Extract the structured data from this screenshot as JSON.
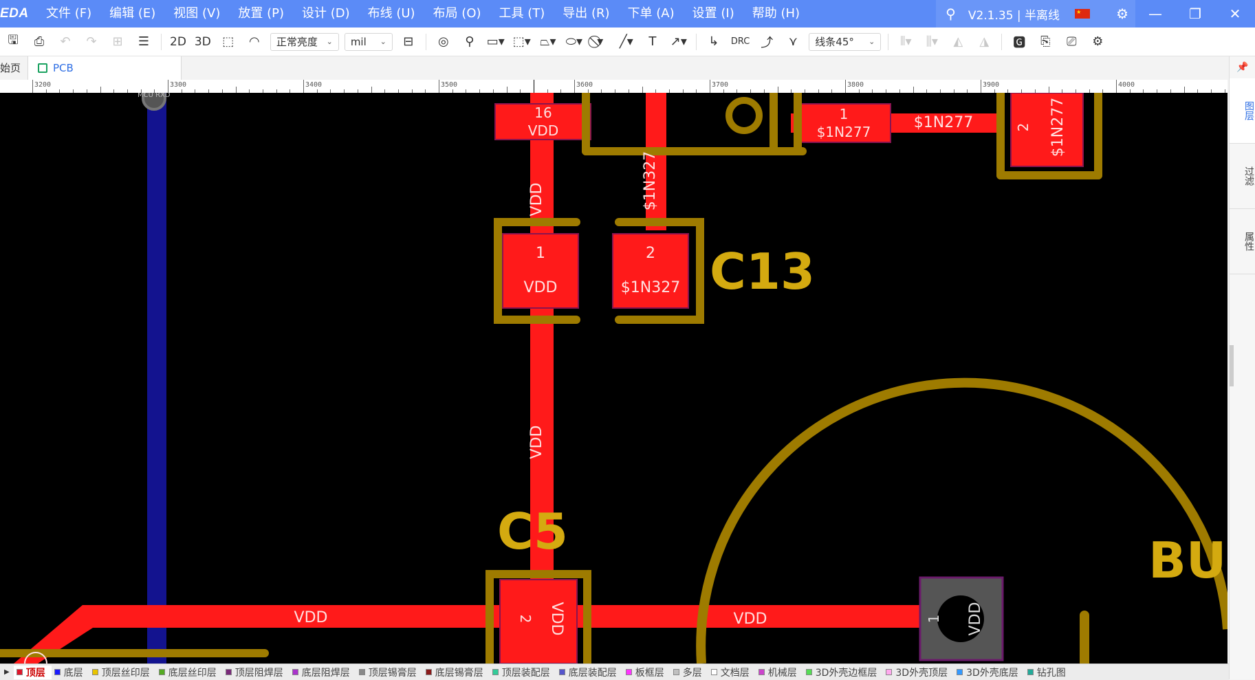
{
  "app": {
    "logo": "EDA",
    "version": "V2.1.35 | 半离线"
  },
  "menu": [
    "文件 (F)",
    "编辑 (E)",
    "视图 (V)",
    "放置 (P)",
    "设计 (D)",
    "布线 (U)",
    "布局 (O)",
    "工具 (T)",
    "导出 (R)",
    "下单 (A)",
    "设置 (I)",
    "帮助 (H)"
  ],
  "toolbar": {
    "view_2d": "2D",
    "view_3d": "3D",
    "brightness": "正常亮度",
    "unit": "mil",
    "drc": "DRC",
    "route_mode": "线条45°"
  },
  "tabs": {
    "home": "始页",
    "pcb": "PCB"
  },
  "ruler": [
    "3200",
    "3300",
    "3400",
    "3500",
    "3600",
    "3700",
    "3800",
    "3900",
    "4000"
  ],
  "side_tabs": [
    "图层",
    "过滤",
    "属性"
  ],
  "layers": [
    {
      "name": "顶层",
      "color": "#e0152a",
      "active": true
    },
    {
      "name": "底层",
      "color": "#1a1aff"
    },
    {
      "name": "顶层丝印层",
      "color": "#e8c400"
    },
    {
      "name": "底层丝印层",
      "color": "#55aa22"
    },
    {
      "name": "顶层阻焊层",
      "color": "#7a2a7a"
    },
    {
      "name": "底层阻焊层",
      "color": "#aa33cc"
    },
    {
      "name": "顶层锡膏层",
      "color": "#888888"
    },
    {
      "name": "底层锡膏层",
      "color": "#8b1a1a"
    },
    {
      "name": "顶层装配层",
      "color": "#33cc99"
    },
    {
      "name": "底层装配层",
      "color": "#5555cc"
    },
    {
      "name": "板框层",
      "color": "#ff33ff"
    },
    {
      "name": "多层",
      "color": "#c0c0c0"
    },
    {
      "name": "文档层",
      "color": "#ffffff"
    },
    {
      "name": "机械层",
      "color": "#cc44cc"
    },
    {
      "name": "3D外壳边框层",
      "color": "#55dd55"
    },
    {
      "name": "3D外壳顶层",
      "color": "#ffaaee"
    },
    {
      "name": "3D外壳底层",
      "color": "#3399ff"
    },
    {
      "name": "钻孔图",
      "color": "#22aa99"
    }
  ],
  "pcb": {
    "designators": {
      "c13": "C13",
      "c5": "C5",
      "bu": "BU"
    },
    "pad16": {
      "num": "16",
      "net": "VDD"
    },
    "pad_1n277": {
      "num": "1",
      "net": "$1N277"
    },
    "pad2_top_right": {
      "num": "2",
      "net": "$1N277"
    },
    "trace_top_right_net": "$1N277",
    "trace_vertical_net_a": "$1N327",
    "c13_pad1": {
      "num": "1",
      "net": "VDD"
    },
    "c13_pad2": {
      "num": "2",
      "net": "$1N327"
    },
    "trace_vdd_upper": "VDD",
    "trace_vdd_middle": "VDD",
    "trace_vdd_horizontal_left": "VDD",
    "trace_vdd_horizontal_right": "VDD",
    "c5_pad2": {
      "num": "2",
      "net": "VDD"
    },
    "bu_pad1": {
      "num": "1",
      "net": "VDD"
    },
    "mcu_label": "MCU RXD"
  }
}
